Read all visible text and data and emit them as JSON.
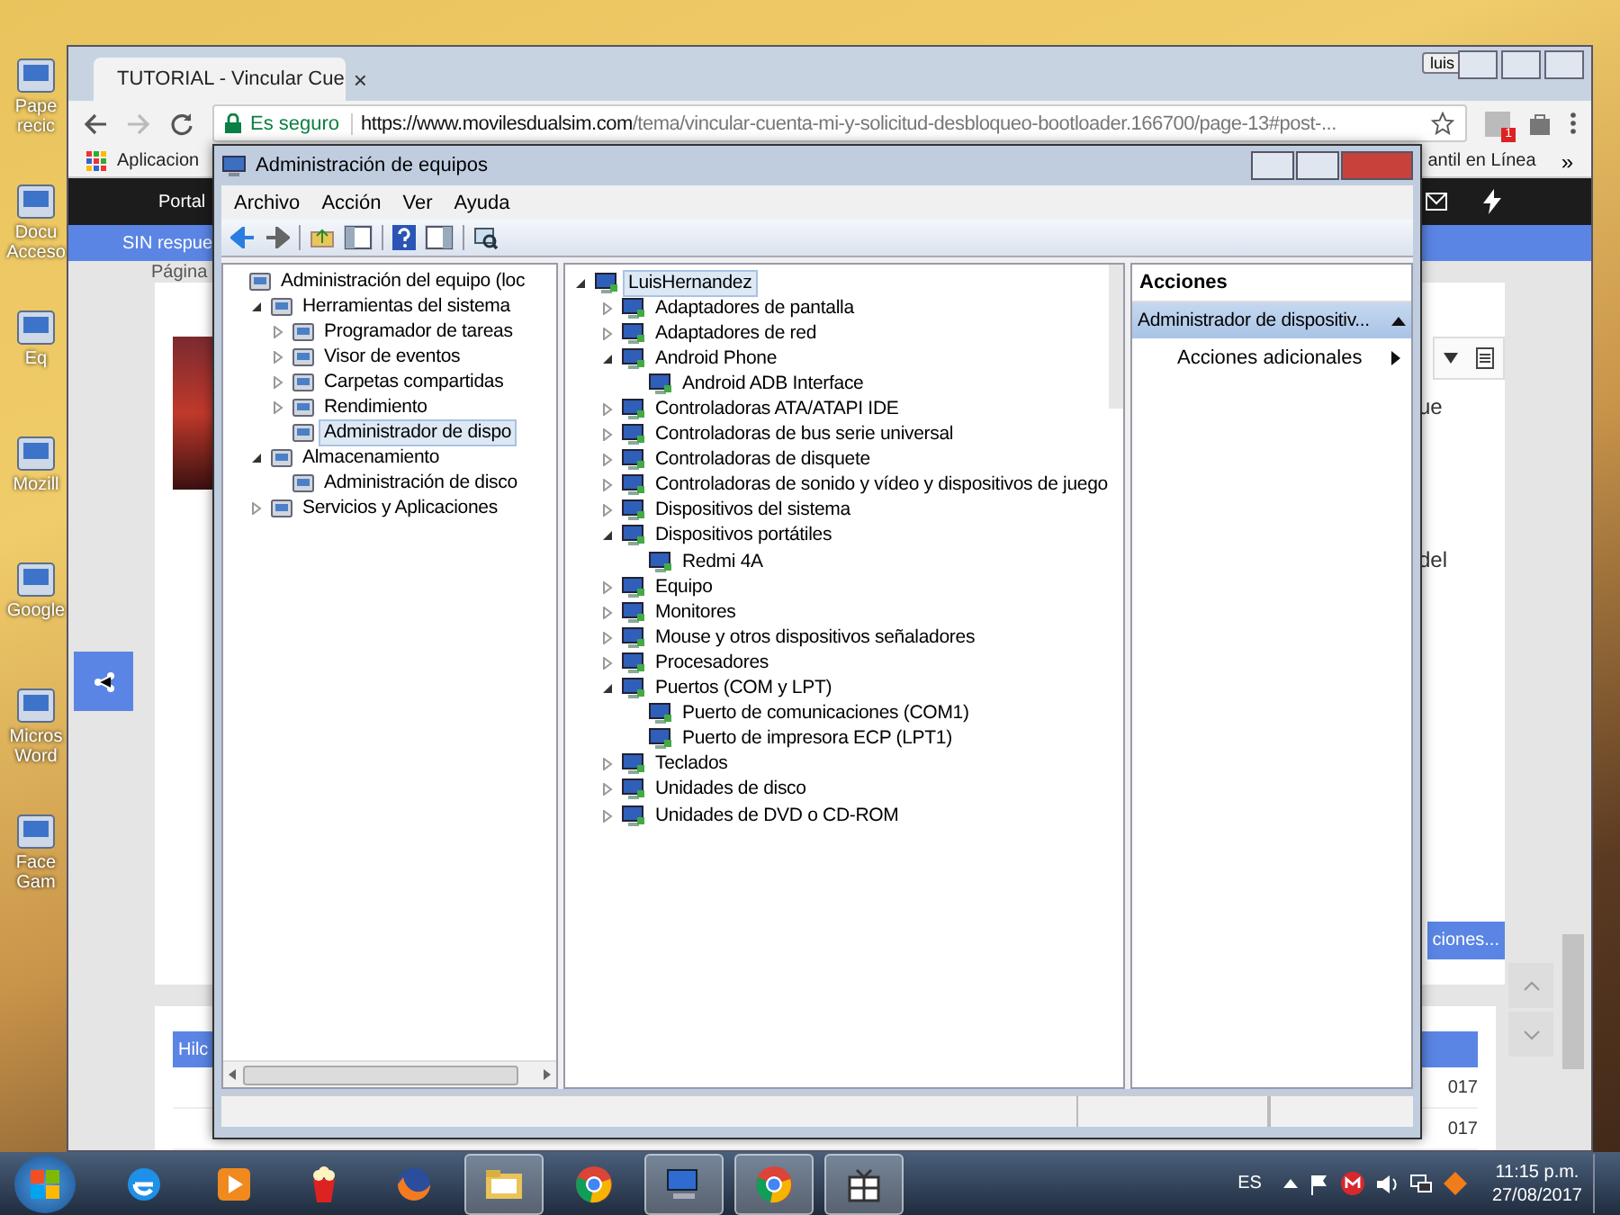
{
  "desktop_icons": [
    {
      "label": "Pape recic"
    },
    {
      "label": "Docu Acceso"
    },
    {
      "label": "Eq"
    },
    {
      "label": "Mozill"
    },
    {
      "label": "Google"
    },
    {
      "label": "Micros Word"
    },
    {
      "label": "Face Gam"
    }
  ],
  "browser": {
    "tab_title": "TUTORIAL - Vincular Cue",
    "tab_close": "×",
    "security": "Es seguro",
    "url_host": "https://www.movilesdualsim.com",
    "url_path": "/tema/vincular-cuenta-mi-y-solicitud-desbloqueo-bootloader.166700/page-13#post-...",
    "extension_badge": "1",
    "bookmarks_left": "Aplicacion",
    "bookmarks_right": "antil en Línea",
    "bookmarks_more": "»",
    "profile": "luis",
    "page": {
      "nav_item": "Portal",
      "banner": "SIN respue",
      "pager": "Página",
      "snippet_1": "ue",
      "snippet_2": "del",
      "action_button": "ciones...",
      "list_header": "Hilc",
      "dates": [
        "017",
        "017"
      ]
    }
  },
  "mmc": {
    "title": "Administración de equipos",
    "menu": [
      "Archivo",
      "Acción",
      "Ver",
      "Ayuda"
    ],
    "left_tree": [
      {
        "label": "Administración del equipo (loc",
        "selected": false,
        "children": [
          {
            "label": "Herramientas del sistema",
            "expanded": true,
            "selected": false,
            "children": [
              {
                "label": "Programador de tareas",
                "expanded": false,
                "selected": false
              },
              {
                "label": "Visor de eventos",
                "expanded": false,
                "selected": false
              },
              {
                "label": "Carpetas compartidas",
                "expanded": false,
                "selected": false
              },
              {
                "label": "Rendimiento",
                "expanded": false,
                "selected": false
              },
              {
                "label": "Administrador de dispo",
                "selected": true
              }
            ]
          },
          {
            "label": "Almacenamiento",
            "expanded": true,
            "selected": false,
            "children": [
              {
                "label": "Administración de disco",
                "selected": false
              }
            ]
          },
          {
            "label": "Servicios y Aplicaciones",
            "expanded": false,
            "selected": false
          }
        ]
      }
    ],
    "device_tree": [
      {
        "label": "LuisHernandez",
        "expanded": true,
        "selected": true,
        "children": [
          {
            "label": "Adaptadores de pantalla",
            "expanded": false,
            "selected": false
          },
          {
            "label": "Adaptadores de red",
            "expanded": false,
            "selected": false
          },
          {
            "label": "Android Phone",
            "expanded": true,
            "selected": false,
            "children": [
              {
                "label": "Android ADB Interface",
                "selected": false
              }
            ]
          },
          {
            "label": "Controladoras ATA/ATAPI IDE",
            "expanded": false,
            "selected": false
          },
          {
            "label": "Controladoras de bus serie universal",
            "expanded": false,
            "selected": false
          },
          {
            "label": "Controladoras de disquete",
            "expanded": false,
            "selected": false
          },
          {
            "label": "Controladoras de sonido y vídeo y dispositivos de juego",
            "expanded": false,
            "selected": false
          },
          {
            "label": "Dispositivos del sistema",
            "expanded": false,
            "selected": false
          },
          {
            "label": "Dispositivos portátiles",
            "expanded": true,
            "selected": false,
            "children": [
              {
                "label": "Redmi 4A",
                "selected": false
              }
            ]
          },
          {
            "label": "Equipo",
            "expanded": false,
            "selected": false
          },
          {
            "label": "Monitores",
            "expanded": false,
            "selected": false
          },
          {
            "label": "Mouse y otros dispositivos señaladores",
            "expanded": false,
            "selected": false
          },
          {
            "label": "Procesadores",
            "expanded": false,
            "selected": false
          },
          {
            "label": "Puertos (COM y LPT)",
            "expanded": true,
            "selected": false,
            "children": [
              {
                "label": "Puerto de comunicaciones (COM1)",
                "selected": false
              },
              {
                "label": "Puerto de impresora ECP (LPT1)",
                "selected": false
              }
            ]
          },
          {
            "label": "Teclados",
            "expanded": false,
            "selected": false
          },
          {
            "label": "Unidades de disco",
            "expanded": false,
            "selected": false
          },
          {
            "label": "Unidades de DVD o CD-ROM",
            "expanded": false,
            "selected": false
          }
        ]
      }
    ],
    "actions": {
      "header": "Acciones",
      "section": "Administrador de dispositiv...",
      "item": "Acciones adicionales"
    }
  },
  "taskbar": {
    "apps": [
      {
        "kind": "e-logo",
        "active": false
      },
      {
        "kind": "play",
        "active": false
      },
      {
        "kind": "popcorn",
        "active": false
      },
      {
        "kind": "fox",
        "active": false
      },
      {
        "kind": "folder",
        "active": true
      },
      {
        "kind": "chrome",
        "active": false
      },
      {
        "kind": "computer",
        "active": true
      },
      {
        "kind": "chrome",
        "active": true
      },
      {
        "kind": "gift",
        "active": true
      }
    ],
    "language": "ES",
    "time": "11:15 p.m.",
    "date": "27/08/2017"
  }
}
